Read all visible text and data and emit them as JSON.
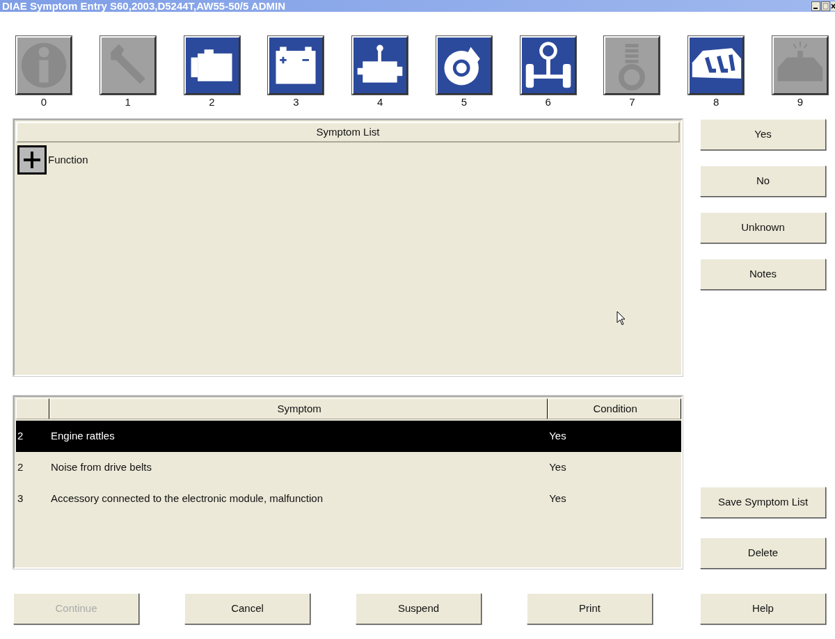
{
  "window": {
    "title": "DIAE Symptom Entry S60,2003,D5244T,AW55-50/5 ADMIN"
  },
  "category_icons": [
    {
      "kind": "info",
      "label": "0",
      "enabled": false
    },
    {
      "kind": "wrench",
      "label": "1",
      "enabled": false
    },
    {
      "kind": "engine",
      "label": "2",
      "enabled": true
    },
    {
      "kind": "battery",
      "label": "3",
      "enabled": true
    },
    {
      "kind": "gearbox",
      "label": "4",
      "enabled": true
    },
    {
      "kind": "brake",
      "label": "5",
      "enabled": true
    },
    {
      "kind": "steering",
      "label": "6",
      "enabled": true
    },
    {
      "kind": "suspension",
      "label": "7",
      "enabled": false
    },
    {
      "kind": "body",
      "label": "8",
      "enabled": true
    },
    {
      "kind": "alarm",
      "label": "9",
      "enabled": false
    }
  ],
  "symptom_list": {
    "title": "Symptom List",
    "items": [
      {
        "label": "Function",
        "expanded": false
      }
    ]
  },
  "side_buttons": [
    {
      "label": "Yes"
    },
    {
      "label": "No"
    },
    {
      "label": "Unknown"
    },
    {
      "label": "Notes"
    }
  ],
  "side_buttons_lower": [
    {
      "label": "Save Symptom List"
    },
    {
      "label": "Delete"
    }
  ],
  "table": {
    "columns": [
      "Symptom",
      "Condition"
    ],
    "rows": [
      {
        "column_1": "2",
        "symptom": "Engine rattles",
        "condition": "Yes",
        "selected": true
      },
      {
        "column_1": "2",
        "symptom": "Noise from drive belts",
        "condition": "Yes",
        "selected": false
      },
      {
        "column_1": "3",
        "symptom": "Accessory connected to the electronic module, malfunction",
        "condition": "Yes",
        "selected": false
      }
    ]
  },
  "bottom_buttons": [
    {
      "label": "Continue",
      "disabled": true
    },
    {
      "label": "Cancel",
      "disabled": false
    },
    {
      "label": "Suspend",
      "disabled": false
    },
    {
      "label": "Print",
      "disabled": false
    },
    {
      "label": "Help",
      "disabled": false
    }
  ]
}
